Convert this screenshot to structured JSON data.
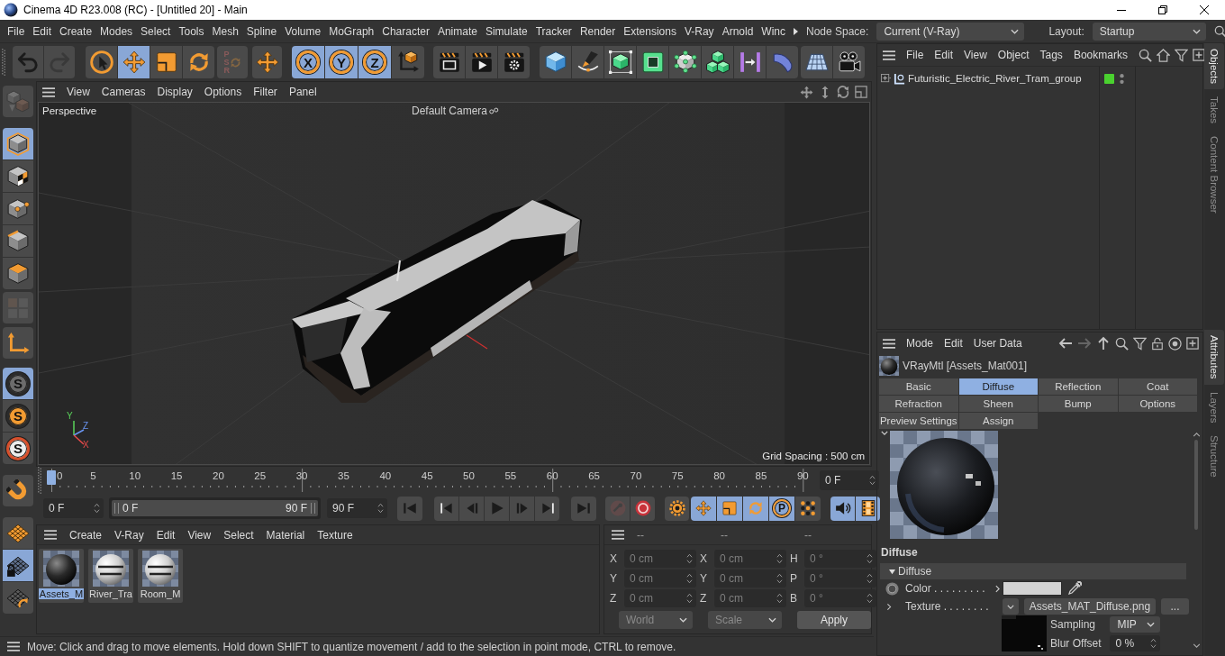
{
  "window": {
    "title": "Cinema 4D R23.008 (RC) - [Untitled 20] - Main"
  },
  "menu_bar": {
    "items": [
      "File",
      "Edit",
      "Create",
      "Modes",
      "Select",
      "Tools",
      "Mesh",
      "Spline",
      "Volume",
      "MoGraph",
      "Character",
      "Animate",
      "Simulate",
      "Tracker",
      "Render",
      "Extensions",
      "V-Ray",
      "Arnold",
      "Winc"
    ],
    "node_space": {
      "label": "Node Space:",
      "value": "Current (V-Ray)"
    },
    "layout": {
      "label": "Layout:",
      "value": "Startup"
    }
  },
  "toolbar": {
    "groups": [
      [
        {
          "kind": "undo",
          "selected": false,
          "disabled": false
        },
        {
          "kind": "redo",
          "selected": false,
          "disabled": true
        }
      ],
      [
        {
          "kind": "liveselect",
          "selected": false,
          "disabled": false
        },
        {
          "kind": "move",
          "selected": true,
          "disabled": false
        },
        {
          "kind": "scale",
          "selected": false,
          "disabled": false
        },
        {
          "kind": "rotate",
          "selected": false,
          "disabled": false
        }
      ],
      [
        {
          "kind": "psr",
          "glyph": "PSR",
          "selected": false,
          "disabled": true
        }
      ],
      [
        {
          "kind": "quickmove",
          "selected": false,
          "disabled": false
        }
      ],
      [
        {
          "kind": "axis",
          "glyph": "X",
          "selected": true,
          "disabled": false
        },
        {
          "kind": "axis",
          "glyph": "Y",
          "selected": true,
          "disabled": false
        },
        {
          "kind": "axis",
          "glyph": "Z",
          "selected": true,
          "disabled": false
        },
        {
          "kind": "coordsystem",
          "selected": false,
          "disabled": false
        }
      ],
      [
        {
          "kind": "renderview",
          "selected": false,
          "disabled": false
        },
        {
          "kind": "renderpv",
          "selected": false,
          "disabled": false
        },
        {
          "kind": "rendersettings",
          "selected": false,
          "disabled": false
        }
      ],
      [
        {
          "kind": "cube",
          "selected": false,
          "disabled": false
        },
        {
          "kind": "pen",
          "selected": false,
          "disabled": false
        },
        {
          "kind": "subdivide",
          "selected": false,
          "disabled": false
        },
        {
          "kind": "extrude",
          "selected": false,
          "disabled": false
        },
        {
          "kind": "cloner",
          "selected": false,
          "disabled": false
        },
        {
          "kind": "array",
          "selected": false,
          "disabled": false
        },
        {
          "kind": "deformer",
          "selected": false,
          "disabled": false
        },
        {
          "kind": "field",
          "selected": false,
          "disabled": false
        }
      ],
      [
        {
          "kind": "floor",
          "selected": false,
          "disabled": false
        },
        {
          "kind": "camera",
          "selected": false,
          "disabled": false
        }
      ]
    ]
  },
  "left_tools": {
    "groups": [
      [
        {
          "kind": "makeeditable",
          "selected": false,
          "disabled": true
        }
      ],
      [
        {
          "kind": "model",
          "selected": true,
          "disabled": false
        },
        {
          "kind": "texture",
          "selected": false,
          "disabled": false
        },
        {
          "kind": "points",
          "selected": false,
          "disabled": false
        },
        {
          "kind": "edges",
          "selected": false,
          "disabled": false
        },
        {
          "kind": "polygons",
          "selected": false,
          "disabled": false
        }
      ],
      [
        {
          "kind": "uv",
          "selected": false,
          "disabled": true
        }
      ],
      [
        {
          "kind": "axismode",
          "selected": false,
          "disabled": false
        }
      ],
      [
        {
          "kind": "solo",
          "glyph": "S",
          "selected": true,
          "disabled": false
        },
        {
          "kind": "soloself",
          "glyph": "S",
          "selected": false,
          "disabled": false
        },
        {
          "kind": "solohier",
          "glyph": "S",
          "selected": false,
          "disabled": false
        }
      ],
      [
        {
          "kind": "snap",
          "selected": false,
          "disabled": false
        }
      ],
      [
        {
          "kind": "workplane",
          "selected": false,
          "disabled": false
        },
        {
          "kind": "lockworkplane",
          "selected": true,
          "disabled": false
        },
        {
          "kind": "workplanerotate",
          "selected": false,
          "disabled": false
        }
      ]
    ]
  },
  "viewport": {
    "menu": [
      "View",
      "Cameras",
      "Display",
      "Options",
      "Filter",
      "Panel"
    ],
    "view_name": "Perspective",
    "camera": "Default Camera",
    "grid_spacing": "Grid Spacing : 500 cm",
    "axis_labels": [
      "Y",
      "Z",
      "X"
    ]
  },
  "timeline": {
    "ticks": [
      "0",
      "5",
      "10",
      "15",
      "20",
      "25",
      "30",
      "35",
      "40",
      "45",
      "50",
      "55",
      "60",
      "65",
      "70",
      "75",
      "80",
      "85",
      "90"
    ],
    "playhead": {
      "level": 0
    },
    "current_frame": "0 F"
  },
  "transport": {
    "start": "0 F",
    "range": {
      "from": "0 F",
      "to": "90 F",
      "level": 1
    },
    "end": "90 F",
    "groups": [
      [
        {
          "kind": "gostart",
          "selected": false,
          "disabled": false
        }
      ],
      [
        {
          "kind": "prevkey",
          "selected": false,
          "disabled": false
        },
        {
          "kind": "prevframe",
          "selected": false,
          "disabled": false
        },
        {
          "kind": "play",
          "selected": false,
          "disabled": false
        },
        {
          "kind": "nextframe",
          "selected": false,
          "disabled": false
        },
        {
          "kind": "nextkey",
          "selected": false,
          "disabled": false
        }
      ],
      [
        {
          "kind": "goend",
          "selected": false,
          "disabled": false
        }
      ],
      [
        {
          "kind": "record",
          "selected": false,
          "disabled": true
        },
        {
          "kind": "autokey",
          "selected": false,
          "disabled": false
        }
      ],
      [
        {
          "kind": "keysettings",
          "selected": false,
          "disabled": false
        }
      ],
      [
        {
          "kind": "keymove",
          "selected": true,
          "disabled": false
        },
        {
          "kind": "keyscale",
          "selected": true,
          "disabled": false
        },
        {
          "kind": "keyrotate",
          "selected": true,
          "disabled": false
        },
        {
          "kind": "keyparam",
          "glyph": "P",
          "selected": true,
          "disabled": false
        },
        {
          "kind": "keypla",
          "selected": false,
          "disabled": false
        }
      ],
      [
        {
          "kind": "sound",
          "selected": true,
          "disabled": false
        },
        {
          "kind": "film",
          "selected": true,
          "disabled": false
        }
      ]
    ]
  },
  "materials": {
    "menu": [
      "Create",
      "V-Ray",
      "Edit",
      "View",
      "Select",
      "Material",
      "Texture"
    ],
    "items": [
      {
        "name": "Assets_M",
        "selected": true
      },
      {
        "name": "River_Tra",
        "selected": false
      },
      {
        "name": "Room_M",
        "selected": false
      }
    ]
  },
  "coordinates": {
    "headers": [
      "--",
      "--",
      "--"
    ],
    "disabled": true,
    "rows": [
      [
        {
          "axis": "X",
          "value": "0 cm"
        },
        {
          "axis": "X",
          "value": "0 cm"
        },
        {
          "axis": "H",
          "value": "0 °"
        }
      ],
      [
        {
          "axis": "Y",
          "value": "0 cm"
        },
        {
          "axis": "Y",
          "value": "0 cm"
        },
        {
          "axis": "P",
          "value": "0 °"
        }
      ],
      [
        {
          "axis": "Z",
          "value": "0 cm"
        },
        {
          "axis": "Z",
          "value": "0 cm"
        },
        {
          "axis": "B",
          "value": "0 °"
        }
      ]
    ],
    "dropdowns": [
      "World",
      "Scale"
    ],
    "apply": "Apply"
  },
  "status_bar": {
    "text": "Move: Click and drag to move elements. Hold down SHIFT to quantize movement / add to the selection in point mode, CTRL to remove."
  },
  "objects": {
    "menu": [
      "File",
      "Edit",
      "View",
      "Object",
      "Tags",
      "Bookmarks"
    ],
    "items": [
      {
        "name": "Futuristic_Electric_River_Tram_group",
        "expanded": false,
        "selected": false,
        "enabled": true
      }
    ]
  },
  "side_tabs": {
    "upper": [
      {
        "label": "Objects",
        "selected": true
      },
      {
        "label": "Takes",
        "selected": false
      },
      {
        "label": "Content Browser",
        "selected": false
      }
    ],
    "lower": [
      {
        "label": "Attributes",
        "selected": true
      },
      {
        "label": "Layers",
        "selected": false
      },
      {
        "label": "Structure",
        "selected": false
      }
    ]
  },
  "attributes": {
    "menu": [
      "Mode",
      "Edit",
      "User Data"
    ],
    "nav": [
      {
        "kind": "back",
        "disabled": false
      },
      {
        "kind": "forward",
        "disabled": true
      },
      {
        "kind": "up",
        "disabled": false
      }
    ],
    "material": "VRayMtl [Assets_Mat001]",
    "tabs": [
      {
        "label": "Basic",
        "selected": false
      },
      {
        "label": "Diffuse",
        "selected": true
      },
      {
        "label": "Reflection",
        "selected": false
      },
      {
        "label": "Coat",
        "selected": false
      },
      {
        "label": "Refraction",
        "selected": false
      },
      {
        "label": "Sheen",
        "selected": false
      },
      {
        "label": "Bump",
        "selected": false
      },
      {
        "label": "Options",
        "selected": false
      },
      {
        "label": "Preview Settings",
        "selected": false
      },
      {
        "label": "Assign",
        "selected": false
      }
    ],
    "section": "Diffuse",
    "group": {
      "title": "Diffuse",
      "expanded": true
    },
    "color": {
      "label": "Color . . . . . . . . .",
      "color": "#d3d3d3"
    },
    "texture": {
      "label": "Texture . . . . . . . .",
      "file": "Assets_MAT_Diffuse.png",
      "browse": "...",
      "expanded": false
    },
    "sampling": {
      "label": "Sampling",
      "value": "MIP"
    },
    "blur_offset": {
      "label": "Blur Offset",
      "value": "0 %"
    }
  }
}
